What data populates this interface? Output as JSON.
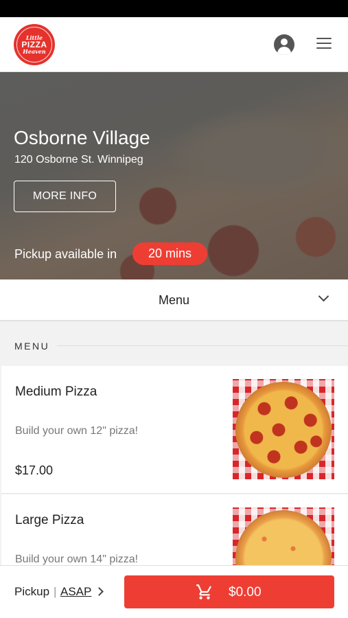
{
  "header": {
    "logo": {
      "line1": "Little",
      "line2": "PIZZA",
      "line3": "Heaven"
    },
    "account_icon": "account-circle-icon",
    "menu_icon": "hamburger-menu-icon"
  },
  "hero": {
    "store_name": "Osborne Village",
    "address": "120 Osborne St. Winnipeg",
    "more_info_label": "MORE INFO",
    "pickup_label": "Pickup available in",
    "pickup_time": "20 mins"
  },
  "menu_selector": {
    "label": "Menu",
    "icon": "chevron-down-icon"
  },
  "section": {
    "title": "MENU"
  },
  "items": [
    {
      "name": "Medium Pizza",
      "description": "Build your own 12\" pizza!",
      "price": "$17.00"
    },
    {
      "name": "Large Pizza",
      "description": "Build your own 14\" pizza!"
    }
  ],
  "bottom_bar": {
    "pickup_mode": "Pickup",
    "separator": "|",
    "pickup_time": "ASAP",
    "cart_total": "$0.00",
    "cart_icon": "shopping-cart-icon"
  },
  "colors": {
    "accent": "#ee3e34",
    "logo_red": "#e5322d"
  }
}
